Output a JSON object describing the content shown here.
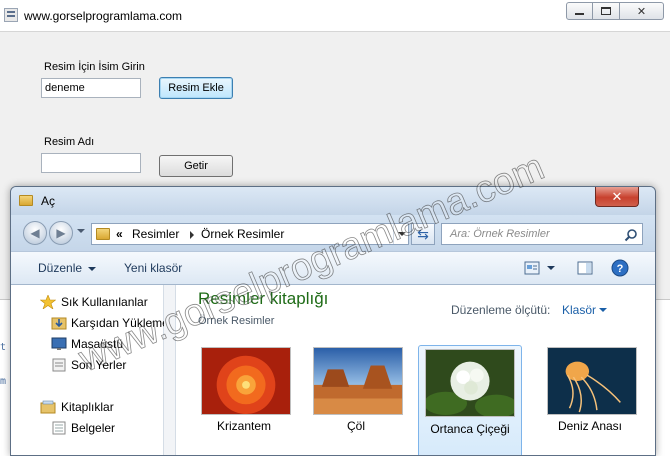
{
  "form": {
    "title": "www.gorselprogramlama.com",
    "label_name_prompt": "Resim İçin İsim Girin",
    "name_input_value": "deneme",
    "add_button": "Resim Ekle",
    "label_image_name": "Resim Adı",
    "image_name_value": "",
    "get_button": "Getir",
    "side_code": [
      "t",
      "m"
    ]
  },
  "dialog": {
    "title": "Aç",
    "close_label": "✕",
    "address": {
      "overflow": "«",
      "crumbs": [
        "Resimler",
        "Örnek Resimler"
      ]
    },
    "search_placeholder": "Ara: Örnek Resimler",
    "toolbar": {
      "organize": "Düzenle",
      "new_folder": "Yeni klasör"
    },
    "nav": {
      "favorites": "Sık Kullanılanlar",
      "downloads": "Karşıdan Yükleme",
      "desktop": "Masaüstü",
      "recent": "Son Yerler",
      "libraries": "Kitaplıklar",
      "documents": "Belgeler"
    },
    "library": {
      "title": "Resimler kitaplığı",
      "subtitle": "Örnek Resimler",
      "arrange_label": "Düzenleme ölçütü:",
      "arrange_value": "Klasör"
    },
    "files": [
      {
        "name": "Krizantem",
        "selected": false
      },
      {
        "name": "Çöl",
        "selected": false
      },
      {
        "name": "Ortanca Çiçeği",
        "selected": true
      },
      {
        "name": "Deniz Anası",
        "selected": false
      }
    ]
  },
  "watermark": "www.gorselprogramlama.com"
}
